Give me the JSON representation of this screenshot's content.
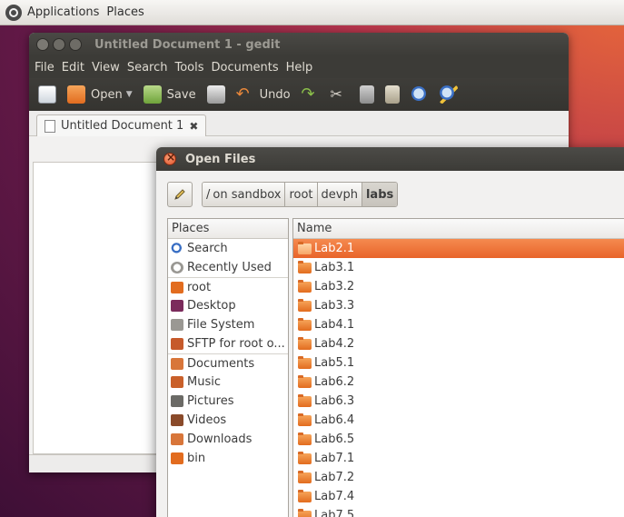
{
  "top_panel": {
    "menu": [
      "Applications",
      "Places"
    ]
  },
  "gedit": {
    "title": "Untitled Document 1 - gedit",
    "menu": [
      "File",
      "Edit",
      "View",
      "Search",
      "Tools",
      "Documents",
      "Help"
    ],
    "toolbar": {
      "open_label": "Open",
      "save_label": "Save",
      "undo_label": "Undo"
    },
    "tab_label": "Untitled Document 1"
  },
  "dialog": {
    "title": "Open Files",
    "path": [
      {
        "label": "/",
        "extra": "on sandbox"
      },
      {
        "label": "root"
      },
      {
        "label": "devph"
      },
      {
        "label": "labs",
        "active": true
      }
    ],
    "places_header": "Places",
    "places": [
      {
        "label": "Search",
        "icon": "search-icon",
        "color": "#3a6fc4"
      },
      {
        "label": "Recently Used",
        "icon": "clock-icon",
        "color": "#9a9893"
      },
      {
        "label": "root",
        "icon": "home-folder-icon",
        "color": "#e26c1f",
        "sep": true
      },
      {
        "label": "Desktop",
        "icon": "desktop-icon",
        "color": "#7b2b5c"
      },
      {
        "label": "File System",
        "icon": "harddisk-icon",
        "color": "#9a9893"
      },
      {
        "label": "SFTP for root o...",
        "icon": "network-folder-icon",
        "color": "#c65a2b"
      },
      {
        "label": "Documents",
        "icon": "documents-folder-icon",
        "color": "#d8763a",
        "sep": true
      },
      {
        "label": "Music",
        "icon": "music-folder-icon",
        "color": "#c9602a"
      },
      {
        "label": "Pictures",
        "icon": "pictures-folder-icon",
        "color": "#6b6a66"
      },
      {
        "label": "Videos",
        "icon": "videos-folder-icon",
        "color": "#8a4a2a"
      },
      {
        "label": "Downloads",
        "icon": "downloads-folder-icon",
        "color": "#d8763a"
      },
      {
        "label": "bin",
        "icon": "folder-icon",
        "color": "#e26c1f"
      }
    ],
    "files_header": "Name",
    "files": [
      {
        "name": "Lab2.1",
        "selected": true
      },
      {
        "name": "Lab3.1"
      },
      {
        "name": "Lab3.2"
      },
      {
        "name": "Lab3.3"
      },
      {
        "name": "Lab4.1"
      },
      {
        "name": "Lab4.2"
      },
      {
        "name": "Lab5.1"
      },
      {
        "name": "Lab6.2"
      },
      {
        "name": "Lab6.3"
      },
      {
        "name": "Lab6.4"
      },
      {
        "name": "Lab6.5"
      },
      {
        "name": "Lab7.1"
      },
      {
        "name": "Lab7.2"
      },
      {
        "name": "Lab7.4"
      },
      {
        "name": "Lab7.5"
      }
    ]
  }
}
